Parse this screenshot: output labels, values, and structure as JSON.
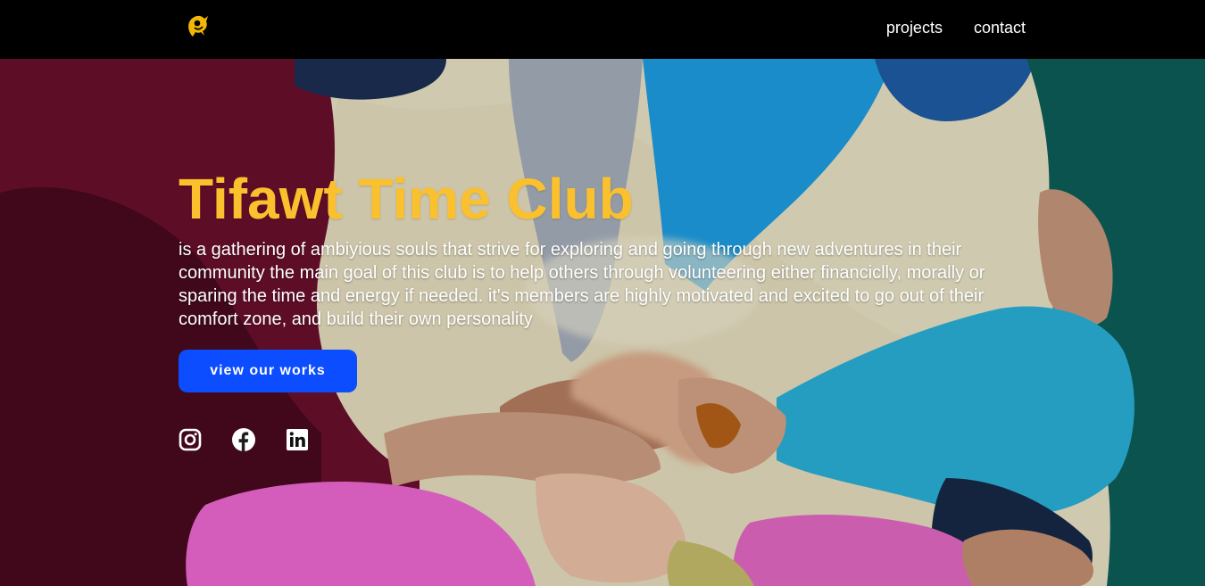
{
  "nav": {
    "logo_icon": "club-logo-icon",
    "links": [
      "projects",
      "contact"
    ]
  },
  "hero": {
    "title": "Tifawt Time Club",
    "description": "is a gathering of ambiyious souls that strive for exploring and going through new adventures in their community the main goal of this club is to help others through volunteering either financiclly, morally or sparing the time and energy if needed. it's members are highly motivated and excited to go out of their comfort zone, and build their own personality",
    "cta_label": "view our works",
    "socials": [
      "instagram-icon",
      "facebook-icon",
      "linkedin-icon"
    ]
  },
  "colors": {
    "title": "#fbc02d",
    "button": "#0b4dff",
    "navbar": "#000000"
  }
}
